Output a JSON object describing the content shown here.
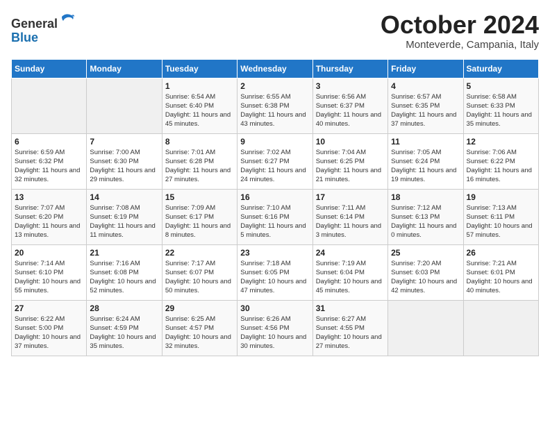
{
  "header": {
    "logo_line1": "General",
    "logo_line2": "Blue",
    "month_title": "October 2024",
    "location": "Monteverde, Campania, Italy"
  },
  "weekdays": [
    "Sunday",
    "Monday",
    "Tuesday",
    "Wednesday",
    "Thursday",
    "Friday",
    "Saturday"
  ],
  "weeks": [
    [
      {
        "day": "",
        "sunrise": "",
        "sunset": "",
        "daylight": ""
      },
      {
        "day": "",
        "sunrise": "",
        "sunset": "",
        "daylight": ""
      },
      {
        "day": "1",
        "sunrise": "Sunrise: 6:54 AM",
        "sunset": "Sunset: 6:40 PM",
        "daylight": "Daylight: 11 hours and 45 minutes."
      },
      {
        "day": "2",
        "sunrise": "Sunrise: 6:55 AM",
        "sunset": "Sunset: 6:38 PM",
        "daylight": "Daylight: 11 hours and 43 minutes."
      },
      {
        "day": "3",
        "sunrise": "Sunrise: 6:56 AM",
        "sunset": "Sunset: 6:37 PM",
        "daylight": "Daylight: 11 hours and 40 minutes."
      },
      {
        "day": "4",
        "sunrise": "Sunrise: 6:57 AM",
        "sunset": "Sunset: 6:35 PM",
        "daylight": "Daylight: 11 hours and 37 minutes."
      },
      {
        "day": "5",
        "sunrise": "Sunrise: 6:58 AM",
        "sunset": "Sunset: 6:33 PM",
        "daylight": "Daylight: 11 hours and 35 minutes."
      }
    ],
    [
      {
        "day": "6",
        "sunrise": "Sunrise: 6:59 AM",
        "sunset": "Sunset: 6:32 PM",
        "daylight": "Daylight: 11 hours and 32 minutes."
      },
      {
        "day": "7",
        "sunrise": "Sunrise: 7:00 AM",
        "sunset": "Sunset: 6:30 PM",
        "daylight": "Daylight: 11 hours and 29 minutes."
      },
      {
        "day": "8",
        "sunrise": "Sunrise: 7:01 AM",
        "sunset": "Sunset: 6:28 PM",
        "daylight": "Daylight: 11 hours and 27 minutes."
      },
      {
        "day": "9",
        "sunrise": "Sunrise: 7:02 AM",
        "sunset": "Sunset: 6:27 PM",
        "daylight": "Daylight: 11 hours and 24 minutes."
      },
      {
        "day": "10",
        "sunrise": "Sunrise: 7:04 AM",
        "sunset": "Sunset: 6:25 PM",
        "daylight": "Daylight: 11 hours and 21 minutes."
      },
      {
        "day": "11",
        "sunrise": "Sunrise: 7:05 AM",
        "sunset": "Sunset: 6:24 PM",
        "daylight": "Daylight: 11 hours and 19 minutes."
      },
      {
        "day": "12",
        "sunrise": "Sunrise: 7:06 AM",
        "sunset": "Sunset: 6:22 PM",
        "daylight": "Daylight: 11 hours and 16 minutes."
      }
    ],
    [
      {
        "day": "13",
        "sunrise": "Sunrise: 7:07 AM",
        "sunset": "Sunset: 6:20 PM",
        "daylight": "Daylight: 11 hours and 13 minutes."
      },
      {
        "day": "14",
        "sunrise": "Sunrise: 7:08 AM",
        "sunset": "Sunset: 6:19 PM",
        "daylight": "Daylight: 11 hours and 11 minutes."
      },
      {
        "day": "15",
        "sunrise": "Sunrise: 7:09 AM",
        "sunset": "Sunset: 6:17 PM",
        "daylight": "Daylight: 11 hours and 8 minutes."
      },
      {
        "day": "16",
        "sunrise": "Sunrise: 7:10 AM",
        "sunset": "Sunset: 6:16 PM",
        "daylight": "Daylight: 11 hours and 5 minutes."
      },
      {
        "day": "17",
        "sunrise": "Sunrise: 7:11 AM",
        "sunset": "Sunset: 6:14 PM",
        "daylight": "Daylight: 11 hours and 3 minutes."
      },
      {
        "day": "18",
        "sunrise": "Sunrise: 7:12 AM",
        "sunset": "Sunset: 6:13 PM",
        "daylight": "Daylight: 11 hours and 0 minutes."
      },
      {
        "day": "19",
        "sunrise": "Sunrise: 7:13 AM",
        "sunset": "Sunset: 6:11 PM",
        "daylight": "Daylight: 10 hours and 57 minutes."
      }
    ],
    [
      {
        "day": "20",
        "sunrise": "Sunrise: 7:14 AM",
        "sunset": "Sunset: 6:10 PM",
        "daylight": "Daylight: 10 hours and 55 minutes."
      },
      {
        "day": "21",
        "sunrise": "Sunrise: 7:16 AM",
        "sunset": "Sunset: 6:08 PM",
        "daylight": "Daylight: 10 hours and 52 minutes."
      },
      {
        "day": "22",
        "sunrise": "Sunrise: 7:17 AM",
        "sunset": "Sunset: 6:07 PM",
        "daylight": "Daylight: 10 hours and 50 minutes."
      },
      {
        "day": "23",
        "sunrise": "Sunrise: 7:18 AM",
        "sunset": "Sunset: 6:05 PM",
        "daylight": "Daylight: 10 hours and 47 minutes."
      },
      {
        "day": "24",
        "sunrise": "Sunrise: 7:19 AM",
        "sunset": "Sunset: 6:04 PM",
        "daylight": "Daylight: 10 hours and 45 minutes."
      },
      {
        "day": "25",
        "sunrise": "Sunrise: 7:20 AM",
        "sunset": "Sunset: 6:03 PM",
        "daylight": "Daylight: 10 hours and 42 minutes."
      },
      {
        "day": "26",
        "sunrise": "Sunrise: 7:21 AM",
        "sunset": "Sunset: 6:01 PM",
        "daylight": "Daylight: 10 hours and 40 minutes."
      }
    ],
    [
      {
        "day": "27",
        "sunrise": "Sunrise: 6:22 AM",
        "sunset": "Sunset: 5:00 PM",
        "daylight": "Daylight: 10 hours and 37 minutes."
      },
      {
        "day": "28",
        "sunrise": "Sunrise: 6:24 AM",
        "sunset": "Sunset: 4:59 PM",
        "daylight": "Daylight: 10 hours and 35 minutes."
      },
      {
        "day": "29",
        "sunrise": "Sunrise: 6:25 AM",
        "sunset": "Sunset: 4:57 PM",
        "daylight": "Daylight: 10 hours and 32 minutes."
      },
      {
        "day": "30",
        "sunrise": "Sunrise: 6:26 AM",
        "sunset": "Sunset: 4:56 PM",
        "daylight": "Daylight: 10 hours and 30 minutes."
      },
      {
        "day": "31",
        "sunrise": "Sunrise: 6:27 AM",
        "sunset": "Sunset: 4:55 PM",
        "daylight": "Daylight: 10 hours and 27 minutes."
      },
      {
        "day": "",
        "sunrise": "",
        "sunset": "",
        "daylight": ""
      },
      {
        "day": "",
        "sunrise": "",
        "sunset": "",
        "daylight": ""
      }
    ]
  ]
}
